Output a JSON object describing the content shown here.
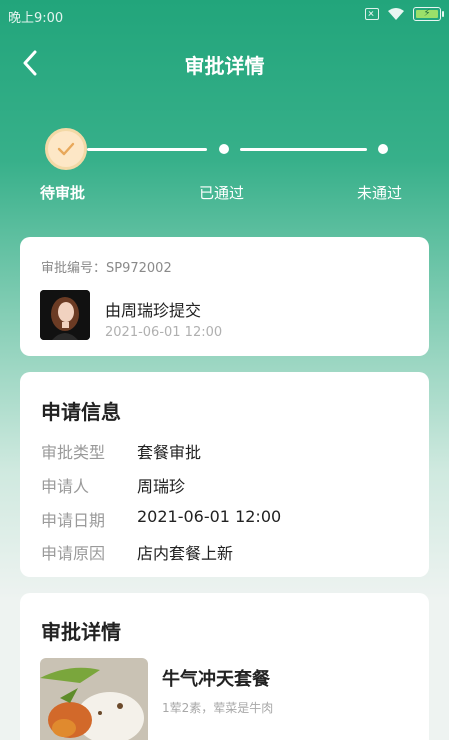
{
  "status_bar": {
    "time": "晚上9:00",
    "icons": [
      "sim-off-icon",
      "wifi-icon",
      "battery-charging-icon"
    ]
  },
  "nav": {
    "title": "审批详情",
    "back_icon": "chevron-left-icon"
  },
  "stepper": {
    "steps": [
      {
        "label": "待审批",
        "state": "current",
        "icon": "check-icon"
      },
      {
        "label": "已通过",
        "state": "pending"
      },
      {
        "label": "未通过",
        "state": "pending"
      }
    ]
  },
  "submission": {
    "approval_no": "审批编号：SP972002",
    "submitter": "由周瑞珍提交",
    "time": "2021-06-01 12:00"
  },
  "application_info": {
    "title": "申请信息",
    "rows": [
      {
        "label": "审批类型",
        "value": "套餐审批"
      },
      {
        "label": "申请人",
        "value": "周瑞珍"
      },
      {
        "label": "申请日期",
        "value": "2021-06-01 12:00"
      },
      {
        "label": "申请原因",
        "value": "店内套餐上新"
      }
    ]
  },
  "approval_detail": {
    "title": "审批详情",
    "item": {
      "name": "牛气冲天套餐",
      "desc": "1荤2素，荤菜是牛肉"
    }
  },
  "colors": {
    "primary_green": "#22a57b",
    "step_active_bg": "#fde7c6",
    "step_check": "#e8a85a"
  }
}
